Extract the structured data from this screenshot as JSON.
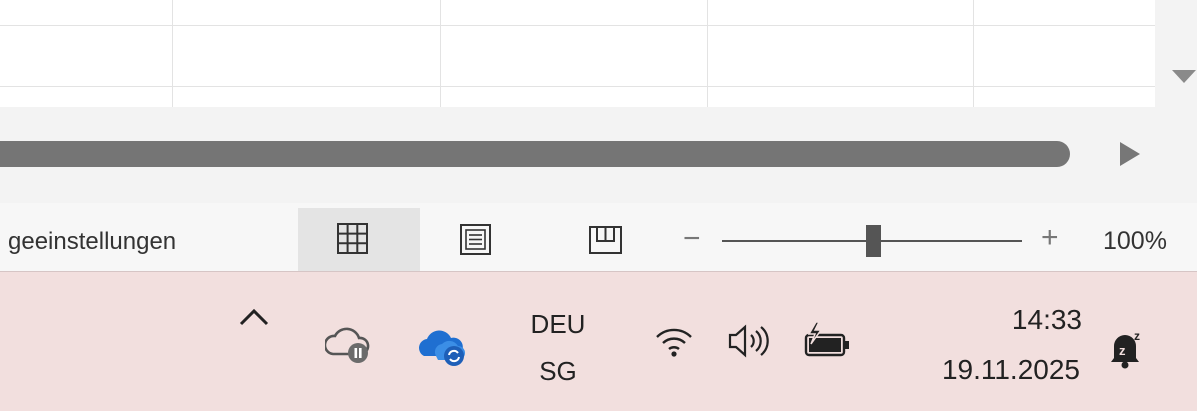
{
  "statusbar": {
    "status_text": "geeinstellungen",
    "view_buttons": [
      "normal-view",
      "page-layout-view",
      "page-break-preview"
    ],
    "zoom": {
      "minus": "−",
      "plus": "+",
      "level": "100%",
      "value_percent": 100
    }
  },
  "taskbar": {
    "tray": {
      "show_hidden_icons": "^",
      "icons": [
        "onedrive-paused-icon",
        "onedrive-sync-icon",
        "wifi-icon",
        "volume-icon",
        "battery-charging-icon"
      ],
      "language": "DEU",
      "layout": "SG"
    },
    "clock": {
      "time": "14:33",
      "date": "19.11.2025"
    },
    "notification_icon": "notifications-snooze-icon"
  },
  "colors": {
    "taskbar_bg": "#f2dfde",
    "statusbar_bg": "#f7f7f7",
    "scroll_thumb": "#757575",
    "onedrive_blue": "#1f6fd1"
  }
}
